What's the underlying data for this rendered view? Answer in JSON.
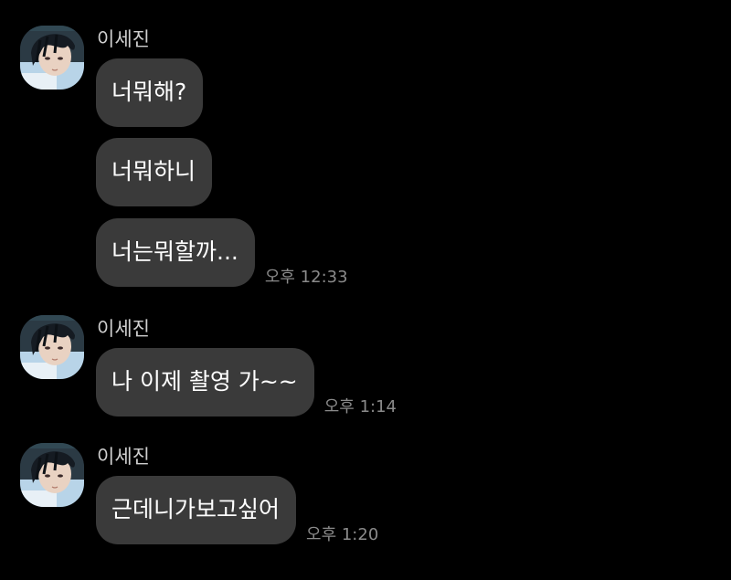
{
  "groups": [
    {
      "sender": "이세진",
      "messages": [
        {
          "text": "너뭐해?",
          "time": ""
        },
        {
          "text": "너뭐하니",
          "time": ""
        },
        {
          "text": "너는뭐할까...",
          "time": "오후 12:33"
        }
      ]
    },
    {
      "sender": "이세진",
      "messages": [
        {
          "text": "나 이제 촬영 가~~",
          "time": "오후 1:14"
        }
      ]
    },
    {
      "sender": "이세진",
      "messages": [
        {
          "text": "근데니가보고싶어",
          "time": "오후 1:20"
        }
      ]
    }
  ],
  "colors": {
    "background": "#000000",
    "bubble": "#3a3a3a",
    "bubble_text": "#ffffff",
    "sender_text": "#cfcfcf",
    "time_text": "#8a8a8a"
  },
  "icons": {
    "avatar": "profile-photo-icon"
  }
}
